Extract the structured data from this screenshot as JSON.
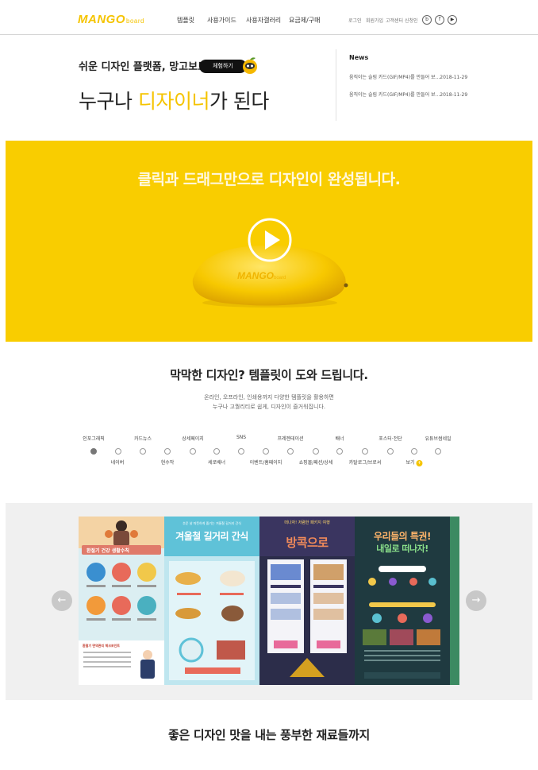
{
  "header": {
    "logo_main": "MANGO",
    "logo_sub": "board",
    "nav": [
      "템플릿",
      "사용가이드",
      "사용자갤러리",
      "요금제/구매"
    ],
    "utils": [
      "로그인",
      "회원가입",
      "고객센터",
      "신청인"
    ],
    "social": [
      "b",
      "f",
      "▶"
    ]
  },
  "hero": {
    "tagline": "쉬운 디자인 플랫폼, 망고보드",
    "try_button": "체험하기",
    "headline_pre": "누구나 ",
    "headline_highlight": "디자이너",
    "headline_post": "가 된다"
  },
  "news": {
    "title": "News",
    "items": [
      "움직이는 슬림 카드(GIF/MP4)를 만들어 보...2018-11-29",
      "움직이는 슬림 카드(GIF/MP4)를 만들어 보...2018-11-29"
    ]
  },
  "banner": {
    "title": "클릭과 드래그만으로 디자인이 완성됩니다.",
    "mango_logo": "MANGO",
    "mango_logo_sub": "board"
  },
  "templates": {
    "title": "막막한 디자인? 템플릿이 도와 드립니다.",
    "desc_line1": "온라인, 오프라인, 인쇄용까지 다양한 템플릿을 활용하면",
    "desc_line2": "누구나 고퀄리티로 쉽게, 디자인이 즐거워집니다.",
    "categories_top": [
      "인포그래픽",
      "카드뉴스",
      "상세페이지",
      "SNS",
      "프레젠테이션",
      "배너",
      "포스터·전단",
      "유튜브썸네일"
    ],
    "categories_bottom": [
      "네이버",
      "현수막",
      "세로배너",
      "이벤트/홈페이지",
      "쇼핑몰/패션/상세",
      "카탈로그/브로셔",
      "보기"
    ],
    "more_badge": "+"
  },
  "carousel": {
    "prev": "←",
    "next": "→",
    "slides": [
      {
        "title": "환절기 건강 생활수칙",
        "sub": "환절기 면역관리 체크포인트"
      },
      {
        "title": "겨울철 길거리 간식",
        "sub": "추운 날 따뜻하게 즐기는 겨울철 길거리 간식"
      },
      {
        "title": "방콕으로",
        "sub": "떠나자! 저렴한 패키지 여행"
      },
      {
        "title": "우리들의 특권!",
        "sub": "내일로 떠나자!"
      }
    ]
  },
  "materials": {
    "title": "좋은 디자인 맛을 내는 풍부한 재료들까지"
  },
  "colors": {
    "brand_yellow": "#f9cd00",
    "dark": "#111111"
  }
}
